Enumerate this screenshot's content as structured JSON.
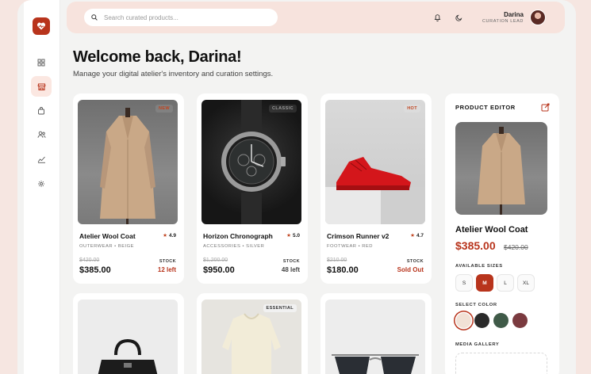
{
  "header": {
    "search_placeholder": "Search curated products...",
    "user_name": "Darina",
    "user_role": "CURATION LEAD"
  },
  "sidebar": {
    "items": [
      {
        "icon": "grid-icon"
      },
      {
        "icon": "store-icon",
        "active": true
      },
      {
        "icon": "bag-icon"
      },
      {
        "icon": "users-icon"
      },
      {
        "icon": "chart-icon"
      },
      {
        "icon": "gear-icon"
      }
    ]
  },
  "welcome": {
    "title": "Welcome back, Darina!",
    "subtitle": "Manage your digital atelier's inventory and curation settings."
  },
  "products": [
    {
      "name": "Atelier Wool Coat",
      "rating": "4.9",
      "meta": "OUTERWEAR • BEIGE",
      "old_price": "$420.00",
      "price": "$385.00",
      "stock_label": "STOCK",
      "stock": "12 left",
      "badge": "NEW"
    },
    {
      "name": "Horizon Chronograph",
      "rating": "5.0",
      "meta": "ACCESSORIES • SILVER",
      "old_price": "$1,200.00",
      "price": "$950.00",
      "stock_label": "STOCK",
      "stock": "48 left",
      "badge": "CLASSIC"
    },
    {
      "name": "Crimson Runner v2",
      "rating": "4.7",
      "meta": "FOOTWEAR • RED",
      "old_price": "$210.00",
      "price": "$180.00",
      "stock_label": "STOCK",
      "stock": "Sold Out",
      "badge": "HOT"
    }
  ],
  "row2": [
    {
      "badge": ""
    },
    {
      "badge": "ESSENTIAL"
    },
    {
      "badge": ""
    }
  ],
  "editor": {
    "title": "PRODUCT EDITOR",
    "name": "Atelier Wool Coat",
    "price": "$385.00",
    "old_price": "$420.00",
    "sizes_label": "AVAILABLE SIZES",
    "sizes": [
      "S",
      "M",
      "L",
      "XL"
    ],
    "selected_size": "M",
    "color_label": "SELECT COLOR",
    "colors": [
      "#f1e1d6",
      "#2a2a2a",
      "#3f5a48",
      "#7a3a3f"
    ],
    "gallery_label": "MEDIA GALLERY"
  },
  "colors": {
    "accent": "#b8341c",
    "header_bg": "#f7e3dd"
  }
}
